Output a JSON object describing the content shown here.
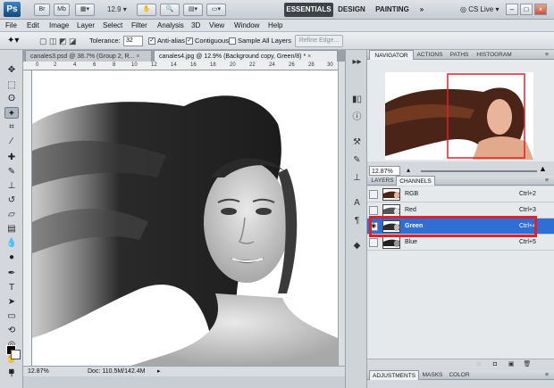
{
  "app": {
    "logo": "Ps",
    "zoom_level": "12.9"
  },
  "appbar": {
    "buttons": [
      "Br",
      "Mb"
    ],
    "workspaces": {
      "essentials": "ESSENTIALS",
      "design": "DESIGN",
      "painting": "PAINTING",
      "more": "»"
    },
    "cs_live": "CS Live",
    "window_controls": {
      "minimize": "–",
      "restore": "□",
      "close": "×"
    }
  },
  "menubar": [
    "File",
    "Edit",
    "Image",
    "Layer",
    "Select",
    "Filter",
    "Analysis",
    "3D",
    "View",
    "Window",
    "Help"
  ],
  "options": {
    "tolerance_label": "Tolerance:",
    "tolerance_value": "32",
    "anti_alias_label": "Anti-alias",
    "anti_alias_checked": true,
    "contiguous_label": "Contiguous",
    "contiguous_checked": true,
    "sample_all_label": "Sample All Layers",
    "sample_all_checked": false,
    "refine_edge": "Refine Edge..."
  },
  "tabs": [
    {
      "label": "canales3.psd @ 38.7% (Group 2, R...",
      "close": "×",
      "active": false
    },
    {
      "label": "canales4.jpg @ 12.9% (Background copy, Green/8) *",
      "close": "×",
      "active": true
    }
  ],
  "ruler_ticks": [
    "0",
    "2",
    "4",
    "6",
    "8",
    "10",
    "12",
    "14",
    "16",
    "18",
    "20",
    "22",
    "24",
    "26",
    "28",
    "30"
  ],
  "status": {
    "zoom": "12.87%",
    "doc": "Doc: 110.5M/142.4M"
  },
  "navigator": {
    "tabs": [
      "NAVIGATOR",
      "ACTIONS",
      "PATHS",
      "HISTOGRAM"
    ],
    "zoom": "12.87%"
  },
  "channels": {
    "tabs": [
      "LAYERS",
      "CHANNELS"
    ],
    "rows": [
      {
        "name": "RGB",
        "shortcut": "Ctrl+2",
        "visible": false,
        "selected": false
      },
      {
        "name": "Red",
        "shortcut": "Ctrl+3",
        "visible": false,
        "selected": false
      },
      {
        "name": "Green",
        "shortcut": "Ctrl+4",
        "visible": true,
        "selected": true
      },
      {
        "name": "Blue",
        "shortcut": "Ctrl+5",
        "visible": false,
        "selected": false
      }
    ]
  },
  "adjustments": {
    "tabs": [
      "ADJUSTMENTS",
      "MASKS",
      "COLOR"
    ]
  },
  "colors": {
    "selection": "#2f6fd5",
    "highlight_box": "#e0202a",
    "nav_view_box": "#e0202a"
  }
}
